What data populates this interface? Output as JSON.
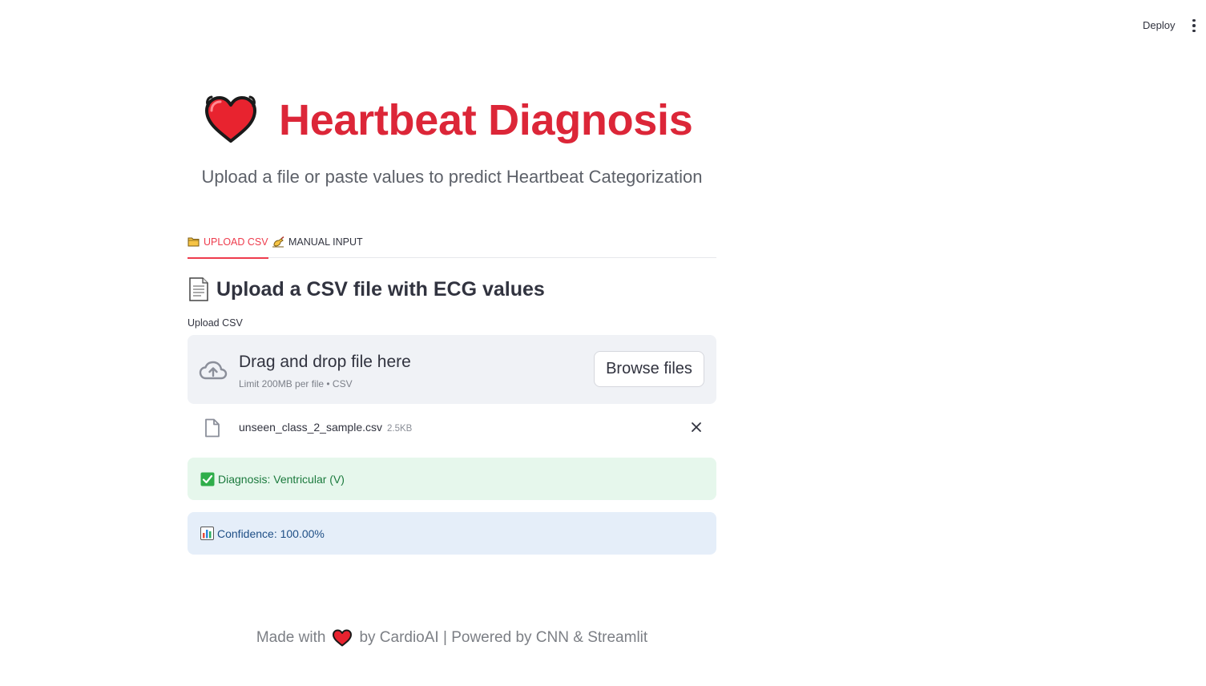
{
  "toolbar": {
    "deploy_label": "Deploy",
    "menu_icon": "kebab-menu-icon"
  },
  "header": {
    "icon": "heart-emoji-icon",
    "title": "Heartbeat Diagnosis",
    "subtitle": "Upload a file or paste values to predict Heartbeat Categorization"
  },
  "tabs": [
    {
      "icon": "folder-icon",
      "label": "UPLOAD CSV",
      "active": true
    },
    {
      "icon": "writing-hand-icon",
      "label": "MANUAL INPUT",
      "active": false
    }
  ],
  "upload": {
    "heading_icon": "page-icon",
    "heading": "Upload a CSV file with ECG values",
    "field_label": "Upload CSV",
    "drop_text": "Drag and drop file here",
    "limit_text": "Limit 200MB per file • CSV",
    "browse_label": "Browse files"
  },
  "file": {
    "name": "unseen_class_2_sample.csv",
    "size": "2.5KB"
  },
  "results": {
    "diagnosis_text": "Diagnosis: Ventricular (V)",
    "confidence_text": "Confidence: 100.00%"
  },
  "footer": {
    "part1": "Made with",
    "part2": "by CardioAI | Powered by CNN & Streamlit"
  },
  "colors": {
    "accent": "#ee3c4d",
    "title": "#dc2638",
    "success_bg": "#e6f7ec",
    "info_bg": "#e5eef9"
  }
}
